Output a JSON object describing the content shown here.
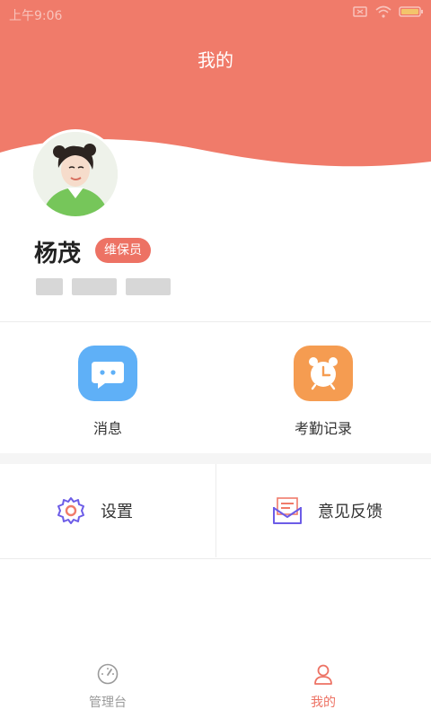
{
  "status_bar": {
    "time": "上午9:06"
  },
  "header": {
    "title": "我的"
  },
  "profile": {
    "name": "杨茂",
    "role": "维保员"
  },
  "shortcuts": [
    {
      "label": "消息",
      "icon": "chat-bubble-icon"
    },
    {
      "label": "考勤记录",
      "icon": "alarm-clock-icon"
    }
  ],
  "menu": [
    {
      "label": "设置",
      "icon": "gear-icon"
    },
    {
      "label": "意见反馈",
      "icon": "feedback-envelope-icon"
    }
  ],
  "tabs": [
    {
      "label": "管理台",
      "icon": "dashboard-gauge-icon",
      "active": false
    },
    {
      "label": "我的",
      "icon": "person-icon",
      "active": true
    }
  ],
  "colors": {
    "header": "#f07b6a",
    "accent": "#ed7264",
    "message_icon": "#5fb0f7",
    "attendance_icon": "#f59c51",
    "menu_icon": "#6c5ce7",
    "tab_inactive": "#9a9a9a"
  }
}
